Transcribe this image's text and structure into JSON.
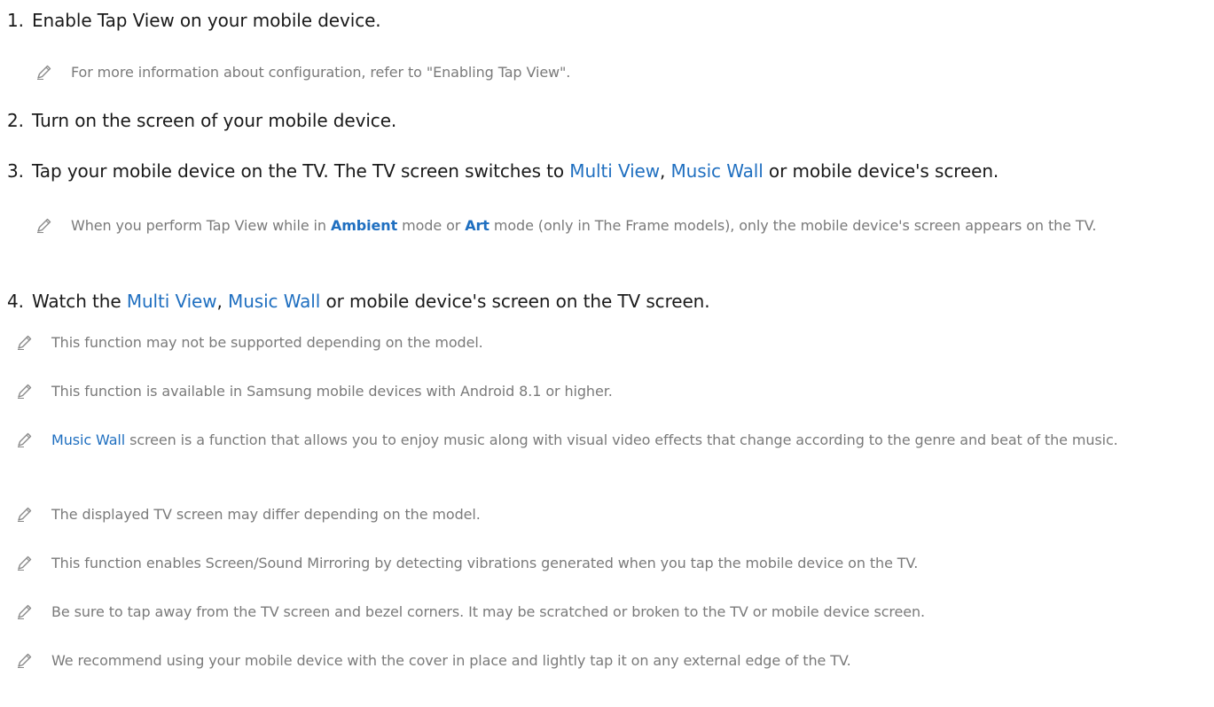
{
  "steps": [
    {
      "number": "1.",
      "text": "Enable Tap View on your mobile device."
    },
    {
      "number": "2.",
      "text": "Turn on the screen of your mobile device."
    },
    {
      "number": "3.",
      "text_a": "Tap your mobile device on the TV. The TV screen switches to ",
      "link_multi_view": "Multi View",
      "sep": ", ",
      "link_music_wall": "Music Wall",
      "text_b": " or mobile device's screen."
    },
    {
      "number": "4.",
      "text_a": "Watch the ",
      "link_multi_view": "Multi View",
      "sep": ", ",
      "link_music_wall": "Music Wall",
      "text_b": " or mobile device's screen on the TV screen."
    }
  ],
  "step_notes": {
    "step1": "For more information about configuration, refer to \"Enabling Tap View\".",
    "step3": {
      "text_a": "When you perform Tap View while in ",
      "link_ambient": "Ambient",
      "text_b": " mode or ",
      "link_art": "Art",
      "text_c": " mode (only in The Frame models), only the mobile device's screen appears on the TV."
    }
  },
  "notes": [
    "This function may not be supported depending on the model.",
    "This function is available in Samsung mobile devices with Android 8.1 or higher.",
    {
      "link_music_wall": "Music Wall",
      "text": " screen is a function that allows you to enjoy music along with visual video effects that change according to the genre and beat of the music."
    },
    "The displayed TV screen may differ depending on the model.",
    "This function enables Screen/Sound Mirroring by detecting vibrations generated when you tap the mobile device on the TV.",
    "Be sure to tap away from the TV screen and bezel corners. It may be scratched or broken to the TV or mobile device screen.",
    "We recommend using your mobile device with the cover in place and lightly tap it on any external edge of the TV."
  ],
  "icons": {
    "note": "pencil-icon"
  },
  "colors": {
    "link": "#1f6fc0",
    "note_text": "#7a7a7a",
    "body_text": "#1a1a1a"
  }
}
